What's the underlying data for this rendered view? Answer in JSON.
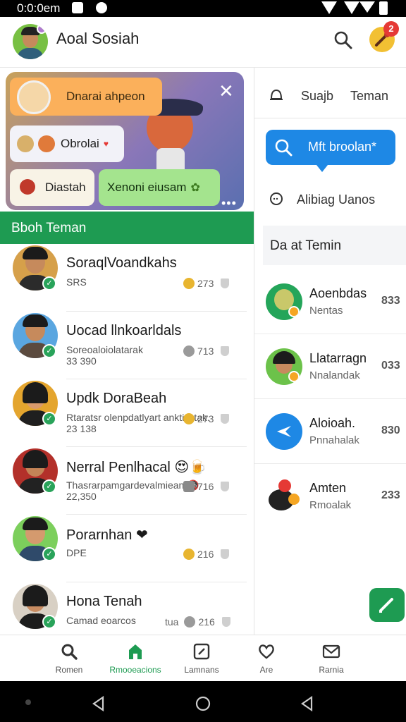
{
  "status_bar": {
    "time": "0:0:0em"
  },
  "header": {
    "title": "Aoal Sosiah",
    "notification_count": "2"
  },
  "banner": {
    "bubble_orange": "Dnarai ahpeon",
    "bubble_white1": "Obrolai",
    "bubble_white2": "Diastah",
    "bubble_green": "Xenoni eiusam",
    "dots": "•••"
  },
  "left_section_title": "Bboh Teman",
  "friends": [
    {
      "name": "SoraqlVoandkahs",
      "sub": "SRS",
      "sub2": "",
      "meta_icon": "",
      "meta_value": "273"
    },
    {
      "name": "Uocad llnkoarldals",
      "sub": "Soreoaloiolatarak",
      "sub2": "33 390",
      "meta_icon": "",
      "meta_value": "713"
    },
    {
      "name": "Updk DoraBeah",
      "sub": "Rtaratsr olenpdatlyart anktisstak.",
      "sub2": "23 138",
      "meta_icon": "",
      "meta_value": "273"
    },
    {
      "name": "Nerral Penlhacal 😍🍺",
      "sub": "Thasrarpamgardevalmiean 🚳",
      "sub2": "22,350",
      "meta_icon": "",
      "meta_value": "716"
    },
    {
      "name": "Porarnhan ❤",
      "sub": "DPE",
      "sub2": "",
      "meta_icon": "",
      "meta_value": "216"
    },
    {
      "name": "Hona Tenah",
      "sub": "Camad eoarcos",
      "sub2": "",
      "meta_icon": "tua",
      "meta_value": "216"
    }
  ],
  "right_panel": {
    "tab1": "Suajb",
    "tab2": "Teman",
    "search_button": "Mft broolan*",
    "chat_label": "Alibiag Uanos",
    "section_title": "Da at Temin",
    "contacts": [
      {
        "name": "Aoenbdas",
        "sub": "Nentas",
        "count": "833"
      },
      {
        "name": "Llatarragn",
        "sub": "Nnalandak",
        "count": "033"
      },
      {
        "name": "Aloioah.",
        "sub": "Pnnahalak",
        "count": "830"
      },
      {
        "name": "Amten",
        "sub": "Rmoalak",
        "count": "233"
      }
    ]
  },
  "bottom_nav": [
    {
      "label": "Romen",
      "icon": "search-icon"
    },
    {
      "label": "Rmooeacions",
      "icon": "home-icon"
    },
    {
      "label": "Lamnans",
      "icon": "note-icon"
    },
    {
      "label": "Are",
      "icon": "heart-icon"
    },
    {
      "label": "Rarnia",
      "icon": "mail-icon"
    }
  ],
  "colors": {
    "brand_green": "#1e9b52",
    "accent_blue": "#1e88e5",
    "badge_red": "#e53935"
  }
}
